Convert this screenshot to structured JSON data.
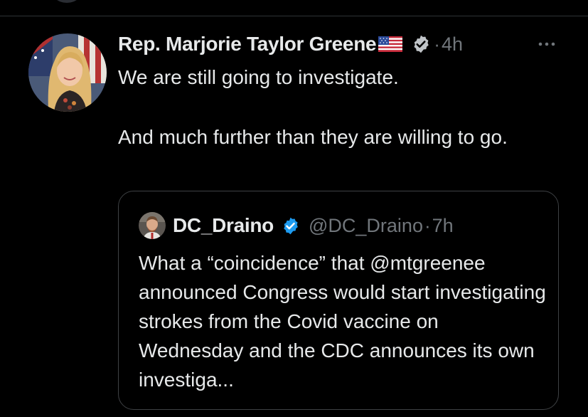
{
  "tweet": {
    "author_name": "Rep. Marjorie Taylor Greene",
    "flag_icon": "us-flag-emoji",
    "verified_icon": "verified-badge-icon",
    "separator": "·",
    "time": "4h",
    "more_icon": "more-horizontal-icon",
    "text_lines": [
      "We are still going to investigate.",
      "And much further than they are willing to go."
    ]
  },
  "quoted_tweet": {
    "author_name": "DC_Draino",
    "verified_icon": "verified-badge-icon",
    "handle": "@DC_Draino",
    "separator": "·",
    "time": "7h",
    "text": "What a “coincidence” that @mtgreenee announced Congress would start investigating strokes from the Covid vaccine on Wednesday and the CDC announces its own investiga..."
  },
  "colors": {
    "background": "#000000",
    "primary_text": "#e7e9ea",
    "secondary_text": "#71767b",
    "verified_blue": "#1d9bf0",
    "border": "#3e4144"
  }
}
